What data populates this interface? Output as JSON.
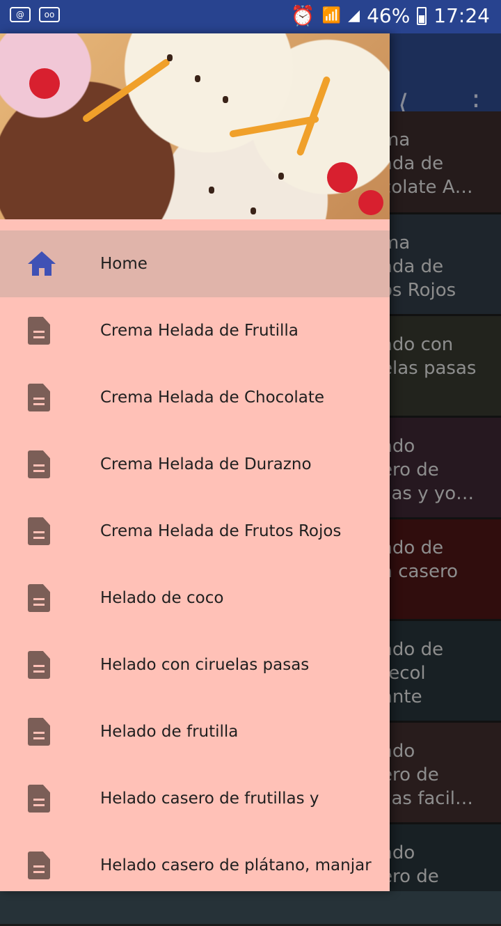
{
  "status_bar": {
    "battery": "46%",
    "time": "17:24"
  },
  "app_bar": {
    "share_icon": "share-icon",
    "more_icon": "more-vert-icon"
  },
  "background_cards": [
    {
      "text": "ma\nada de\ncolate A…",
      "color": "#3a2a2a"
    },
    {
      "text": "ma\nada de\nos Rojos",
      "color": "#2f3a44"
    },
    {
      "text": "ado con\nelas pasas",
      "color": "#35372d"
    },
    {
      "text": "ado\nero de\nllas y yo…",
      "color": "#3b2532"
    },
    {
      "text": "ado de\na casero",
      "color": "#4a1414"
    },
    {
      "text": "ado de\ntecol\nante",
      "color": "#263238"
    },
    {
      "text": "ado\nero de\nllas facil…",
      "color": "#3e2b2b"
    },
    {
      "text": "ado\nero de",
      "color": "#263238"
    }
  ],
  "drawer": {
    "menu": [
      {
        "label": "Home",
        "icon": "home-icon",
        "active": true
      },
      {
        "label": "Crema Helada de Frutilla",
        "icon": "document-icon"
      },
      {
        "label": "Crema Helada de Chocolate",
        "icon": "document-icon"
      },
      {
        "label": "Crema Helada de Durazno",
        "icon": "document-icon"
      },
      {
        "label": "Crema Helada de Frutos Rojos",
        "icon": "document-icon"
      },
      {
        "label": "Helado de coco",
        "icon": "document-icon"
      },
      {
        "label": "Helado con ciruelas pasas",
        "icon": "document-icon"
      },
      {
        "label": "Helado de frutilla",
        "icon": "document-icon"
      },
      {
        "label": "Helado casero de frutillas y",
        "icon": "document-icon"
      },
      {
        "label": "Helado casero de plátano, manjar",
        "icon": "document-icon"
      }
    ]
  }
}
